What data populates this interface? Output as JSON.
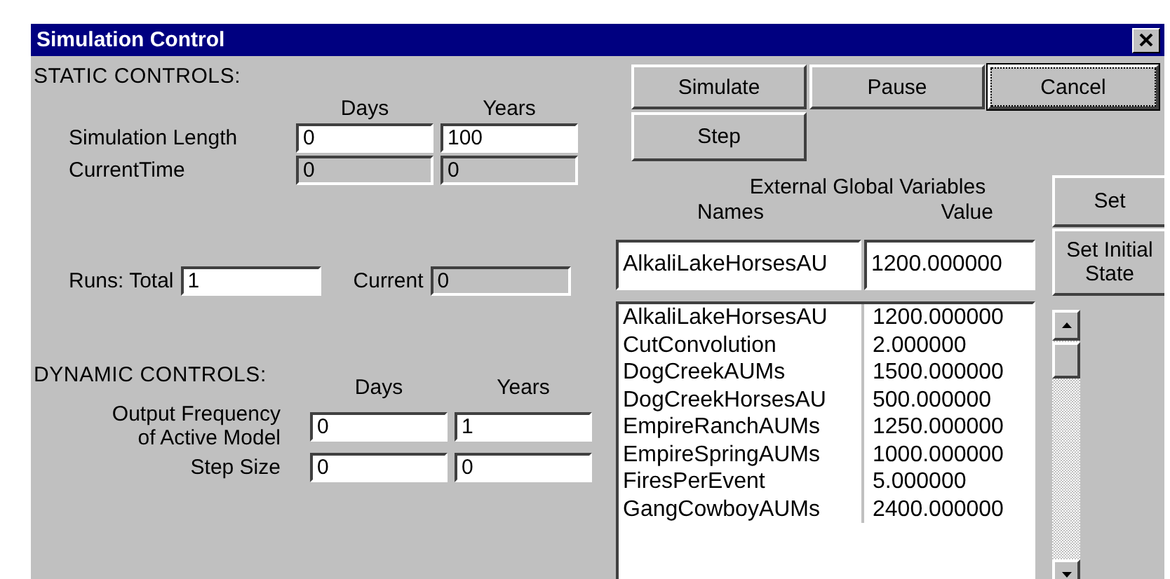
{
  "window": {
    "title": "Simulation Control"
  },
  "static_controls": {
    "heading": "STATIC CONTROLS:",
    "columns": [
      "Days",
      "Years"
    ],
    "rows": [
      {
        "label": "Simulation Length",
        "fields": [
          {
            "value": "0",
            "disabled": false
          },
          {
            "value": "100",
            "disabled": false
          }
        ]
      },
      {
        "label": "CurrentTime",
        "fields": [
          {
            "value": "0",
            "disabled": true
          },
          {
            "value": "0",
            "disabled": true
          }
        ]
      }
    ]
  },
  "runs": {
    "total_label": "Runs: Total",
    "total": {
      "value": "1",
      "disabled": false
    },
    "current_label": "Current",
    "current": {
      "value": "0",
      "disabled": true
    }
  },
  "dynamic_controls": {
    "heading": "DYNAMIC CONTROLS:",
    "columns": [
      "Days",
      "Years"
    ],
    "rows": [
      {
        "label_lines": [
          "Output Frequency",
          "of Active Model"
        ],
        "fields": [
          {
            "value": "0",
            "disabled": false
          },
          {
            "value": "1",
            "disabled": false
          }
        ]
      },
      {
        "label_lines": [
          "Step Size"
        ],
        "fields": [
          {
            "value": "0",
            "disabled": false
          },
          {
            "value": "0",
            "disabled": false
          }
        ]
      }
    ]
  },
  "buttons": [
    {
      "label": "Simulate",
      "default": false
    },
    {
      "label": "Pause",
      "default": false
    },
    {
      "label": "Cancel",
      "default": true
    },
    {
      "label": "Step",
      "default": false
    }
  ],
  "variables": {
    "heading": "External Global Variables",
    "columns": [
      "Names",
      "Value"
    ],
    "edit": {
      "name": "AlkaliLakeHorsesAU",
      "value": "1200.000000"
    },
    "rows": [
      {
        "name": "AlkaliLakeHorsesAU",
        "value": "1200.000000"
      },
      {
        "name": "CutConvolution",
        "value": "2.000000"
      },
      {
        "name": "DogCreekAUMs",
        "value": "1500.000000"
      },
      {
        "name": "DogCreekHorsesAU",
        "value": "500.000000"
      },
      {
        "name": "EmpireRanchAUMs",
        "value": "1250.000000"
      },
      {
        "name": "EmpireSpringAUMs",
        "value": "1000.000000"
      },
      {
        "name": "FiresPerEvent",
        "value": "5.000000"
      },
      {
        "name": "GangCowboyAUMs",
        "value": "2400.000000"
      }
    ],
    "side_buttons": [
      {
        "lines": [
          "Set"
        ]
      },
      {
        "lines": [
          "Set Initial",
          "State"
        ]
      }
    ]
  }
}
